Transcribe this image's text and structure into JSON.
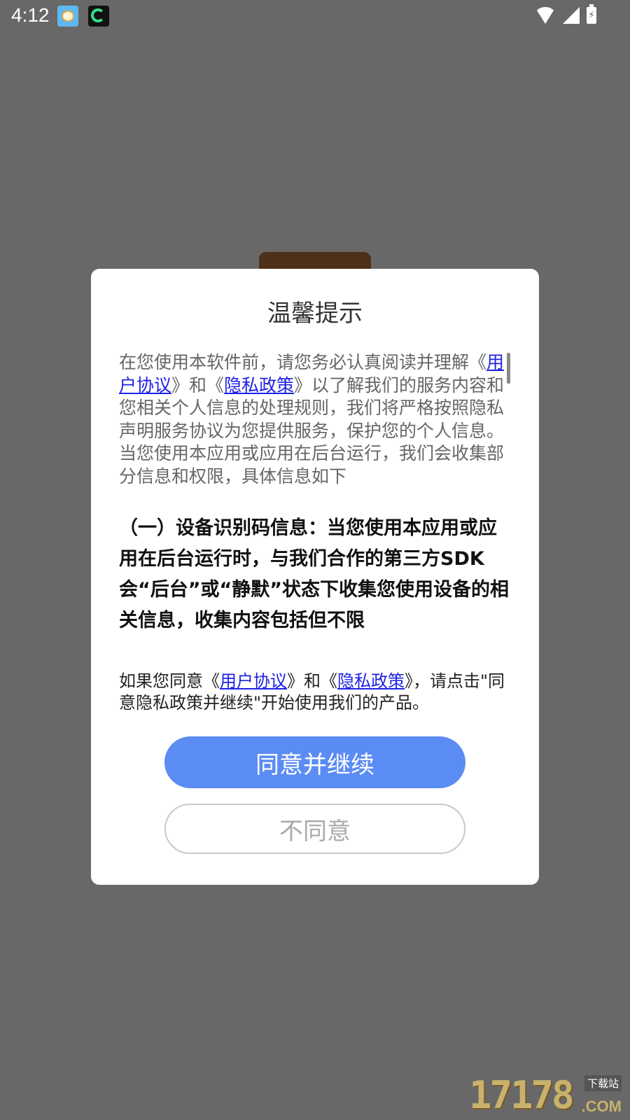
{
  "status_bar": {
    "time": "4:12",
    "icons": [
      "app-icon-baby",
      "app-icon-moon",
      "wifi-icon",
      "signal-icon",
      "battery-charging-icon"
    ]
  },
  "dialog": {
    "title": "温馨提示",
    "intro": {
      "part1": "在您使用本软件前，请您务必认真阅读并理解《",
      "link1": "用户协议",
      "part2": "》和《",
      "link2": "隐私政策",
      "part3": "》以了解我们的服务内容和您相关个人信息的处理规则，我们将严格按照隐私声明服务协议为您提供服务，保护您的个人信息。当您使用本应用或应用在后台运行，我们会收集部分信息和权限，具体信息如下"
    },
    "section1": "（一）设备识别码信息：当您使用本应用或应用在后台运行时，与我们合作的第三方SDK会“后台”或“静默”状态下收集您使用设备的相关信息，收集内容包括但不限",
    "consent": {
      "part1": "如果您同意《",
      "link1": "用户协议",
      "part2": "》和《",
      "link2": "隐私政策",
      "part3": "》，请点击\"同意隐私政策并继续\"开始使用我们的产品。"
    },
    "agree_label": "同意并继续",
    "disagree_label": "不同意"
  },
  "watermark": {
    "number": "17178",
    "label": "下载站",
    "suffix": ".COM"
  },
  "colors": {
    "overlay": "#686868",
    "link": "#1f22e5",
    "primary_button": "#5b8cf4"
  }
}
